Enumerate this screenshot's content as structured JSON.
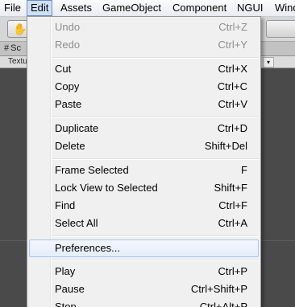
{
  "menubar": {
    "items": [
      "File",
      "Edit",
      "Assets",
      "GameObject",
      "Component",
      "NGUI",
      "Windo"
    ]
  },
  "toolbar": {
    "hand_tool": "hand-icon"
  },
  "scene": {
    "tab_label": "Sc",
    "mode_label": "Textu",
    "dropdown_arrow": "▾"
  },
  "edit_menu": {
    "groups": [
      [
        {
          "label": "Undo",
          "shortcut": "Ctrl+Z",
          "enabled": false
        },
        {
          "label": "Redo",
          "shortcut": "Ctrl+Y",
          "enabled": false
        }
      ],
      [
        {
          "label": "Cut",
          "shortcut": "Ctrl+X",
          "enabled": true
        },
        {
          "label": "Copy",
          "shortcut": "Ctrl+C",
          "enabled": true
        },
        {
          "label": "Paste",
          "shortcut": "Ctrl+V",
          "enabled": true
        }
      ],
      [
        {
          "label": "Duplicate",
          "shortcut": "Ctrl+D",
          "enabled": true
        },
        {
          "label": "Delete",
          "shortcut": "Shift+Del",
          "enabled": true
        }
      ],
      [
        {
          "label": "Frame Selected",
          "shortcut": "F",
          "enabled": true
        },
        {
          "label": "Lock View to Selected",
          "shortcut": "Shift+F",
          "enabled": true
        },
        {
          "label": "Find",
          "shortcut": "Ctrl+F",
          "enabled": true
        },
        {
          "label": "Select All",
          "shortcut": "Ctrl+A",
          "enabled": true
        }
      ],
      [
        {
          "label": "Preferences...",
          "shortcut": "",
          "enabled": true,
          "highlighted": true
        }
      ],
      [
        {
          "label": "Play",
          "shortcut": "Ctrl+P",
          "enabled": true
        },
        {
          "label": "Pause",
          "shortcut": "Ctrl+Shift+P",
          "enabled": true
        },
        {
          "label": "Stop",
          "shortcut": "Ctrl+Alt+P",
          "enabled": true
        }
      ]
    ]
  }
}
